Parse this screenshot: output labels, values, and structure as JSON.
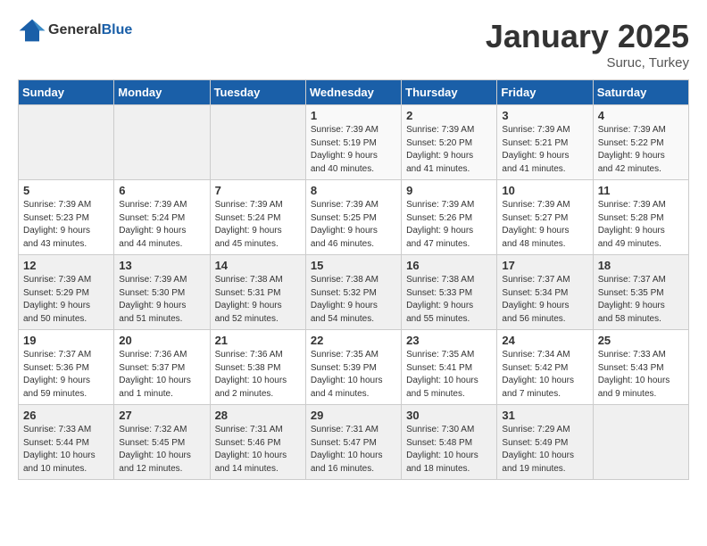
{
  "logo": {
    "general": "General",
    "blue": "Blue"
  },
  "header": {
    "month": "January 2025",
    "location": "Suruc, Turkey"
  },
  "weekdays": [
    "Sunday",
    "Monday",
    "Tuesday",
    "Wednesday",
    "Thursday",
    "Friday",
    "Saturday"
  ],
  "weeks": [
    [
      {
        "day": "",
        "info": ""
      },
      {
        "day": "",
        "info": ""
      },
      {
        "day": "",
        "info": ""
      },
      {
        "day": "1",
        "info": "Sunrise: 7:39 AM\nSunset: 5:19 PM\nDaylight: 9 hours\nand 40 minutes."
      },
      {
        "day": "2",
        "info": "Sunrise: 7:39 AM\nSunset: 5:20 PM\nDaylight: 9 hours\nand 41 minutes."
      },
      {
        "day": "3",
        "info": "Sunrise: 7:39 AM\nSunset: 5:21 PM\nDaylight: 9 hours\nand 41 minutes."
      },
      {
        "day": "4",
        "info": "Sunrise: 7:39 AM\nSunset: 5:22 PM\nDaylight: 9 hours\nand 42 minutes."
      }
    ],
    [
      {
        "day": "5",
        "info": "Sunrise: 7:39 AM\nSunset: 5:23 PM\nDaylight: 9 hours\nand 43 minutes."
      },
      {
        "day": "6",
        "info": "Sunrise: 7:39 AM\nSunset: 5:24 PM\nDaylight: 9 hours\nand 44 minutes."
      },
      {
        "day": "7",
        "info": "Sunrise: 7:39 AM\nSunset: 5:24 PM\nDaylight: 9 hours\nand 45 minutes."
      },
      {
        "day": "8",
        "info": "Sunrise: 7:39 AM\nSunset: 5:25 PM\nDaylight: 9 hours\nand 46 minutes."
      },
      {
        "day": "9",
        "info": "Sunrise: 7:39 AM\nSunset: 5:26 PM\nDaylight: 9 hours\nand 47 minutes."
      },
      {
        "day": "10",
        "info": "Sunrise: 7:39 AM\nSunset: 5:27 PM\nDaylight: 9 hours\nand 48 minutes."
      },
      {
        "day": "11",
        "info": "Sunrise: 7:39 AM\nSunset: 5:28 PM\nDaylight: 9 hours\nand 49 minutes."
      }
    ],
    [
      {
        "day": "12",
        "info": "Sunrise: 7:39 AM\nSunset: 5:29 PM\nDaylight: 9 hours\nand 50 minutes."
      },
      {
        "day": "13",
        "info": "Sunrise: 7:39 AM\nSunset: 5:30 PM\nDaylight: 9 hours\nand 51 minutes."
      },
      {
        "day": "14",
        "info": "Sunrise: 7:38 AM\nSunset: 5:31 PM\nDaylight: 9 hours\nand 52 minutes."
      },
      {
        "day": "15",
        "info": "Sunrise: 7:38 AM\nSunset: 5:32 PM\nDaylight: 9 hours\nand 54 minutes."
      },
      {
        "day": "16",
        "info": "Sunrise: 7:38 AM\nSunset: 5:33 PM\nDaylight: 9 hours\nand 55 minutes."
      },
      {
        "day": "17",
        "info": "Sunrise: 7:37 AM\nSunset: 5:34 PM\nDaylight: 9 hours\nand 56 minutes."
      },
      {
        "day": "18",
        "info": "Sunrise: 7:37 AM\nSunset: 5:35 PM\nDaylight: 9 hours\nand 58 minutes."
      }
    ],
    [
      {
        "day": "19",
        "info": "Sunrise: 7:37 AM\nSunset: 5:36 PM\nDaylight: 9 hours\nand 59 minutes."
      },
      {
        "day": "20",
        "info": "Sunrise: 7:36 AM\nSunset: 5:37 PM\nDaylight: 10 hours\nand 1 minute."
      },
      {
        "day": "21",
        "info": "Sunrise: 7:36 AM\nSunset: 5:38 PM\nDaylight: 10 hours\nand 2 minutes."
      },
      {
        "day": "22",
        "info": "Sunrise: 7:35 AM\nSunset: 5:39 PM\nDaylight: 10 hours\nand 4 minutes."
      },
      {
        "day": "23",
        "info": "Sunrise: 7:35 AM\nSunset: 5:41 PM\nDaylight: 10 hours\nand 5 minutes."
      },
      {
        "day": "24",
        "info": "Sunrise: 7:34 AM\nSunset: 5:42 PM\nDaylight: 10 hours\nand 7 minutes."
      },
      {
        "day": "25",
        "info": "Sunrise: 7:33 AM\nSunset: 5:43 PM\nDaylight: 10 hours\nand 9 minutes."
      }
    ],
    [
      {
        "day": "26",
        "info": "Sunrise: 7:33 AM\nSunset: 5:44 PM\nDaylight: 10 hours\nand 10 minutes."
      },
      {
        "day": "27",
        "info": "Sunrise: 7:32 AM\nSunset: 5:45 PM\nDaylight: 10 hours\nand 12 minutes."
      },
      {
        "day": "28",
        "info": "Sunrise: 7:31 AM\nSunset: 5:46 PM\nDaylight: 10 hours\nand 14 minutes."
      },
      {
        "day": "29",
        "info": "Sunrise: 7:31 AM\nSunset: 5:47 PM\nDaylight: 10 hours\nand 16 minutes."
      },
      {
        "day": "30",
        "info": "Sunrise: 7:30 AM\nSunset: 5:48 PM\nDaylight: 10 hours\nand 18 minutes."
      },
      {
        "day": "31",
        "info": "Sunrise: 7:29 AM\nSunset: 5:49 PM\nDaylight: 10 hours\nand 19 minutes."
      },
      {
        "day": "",
        "info": ""
      }
    ]
  ]
}
